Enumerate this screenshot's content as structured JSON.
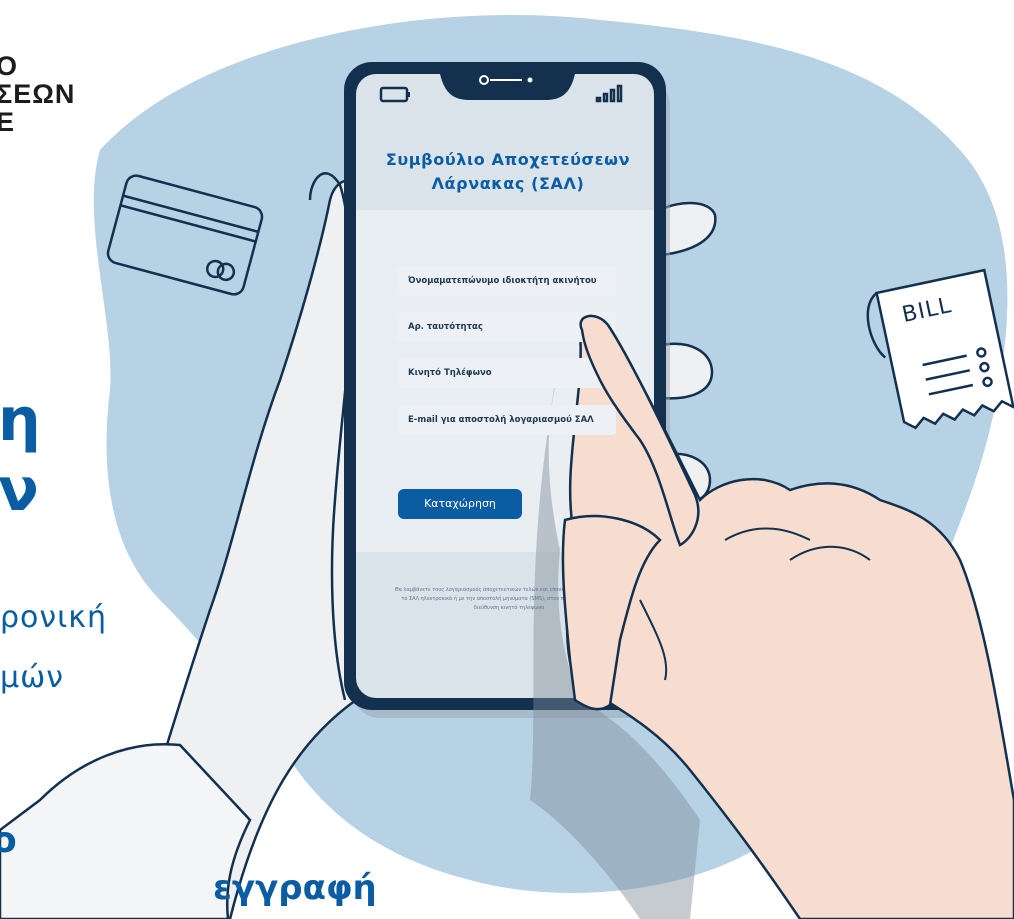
{
  "corner_title_lines": [
    "Ο",
    "ΣΕΩΝ",
    "Ε"
  ],
  "left_heading": {
    "line1": "η",
    "line2": "ν"
  },
  "left_subtext": {
    "line1": "ρονική",
    "line2": "μών"
  },
  "left_small": "ο",
  "bottom_word": "εγγραφή",
  "bill_label": "BILL",
  "phone": {
    "app_title_line1": "Συμβούλιο Αποχετεύσεων",
    "app_title_line2": "Λάρνακας (ΣΑΛ)",
    "fields": [
      {
        "label": "Όνομαματεπώνυμο ιδιοκτήτη ακινήτου"
      },
      {
        "label": "Αρ. ταυτότητας"
      },
      {
        "label": "Κινητό Τηλέφωνο"
      },
      {
        "label": "E-mail για αποστολή λογαριασμού ΣΑΛ"
      }
    ],
    "submit_label": "Καταχώρηση",
    "footnote": "Θα λαμβάνετε τους λογαριασμούς αποχετευτικών τελών και επανειδήσεις ενημέρωση από το ΣΑΛ ηλεκτρονικά ή με την αποστολή μηνύματα (SMS), στον πιο πάνω ηλεκτρονική διεύθυνση κινητό τηλέφωνο"
  },
  "colors": {
    "brand_blue": "#0a5da3",
    "blob": "#b7d1e5",
    "phone_frame": "#13314e",
    "skin": "#f7ddd0"
  }
}
